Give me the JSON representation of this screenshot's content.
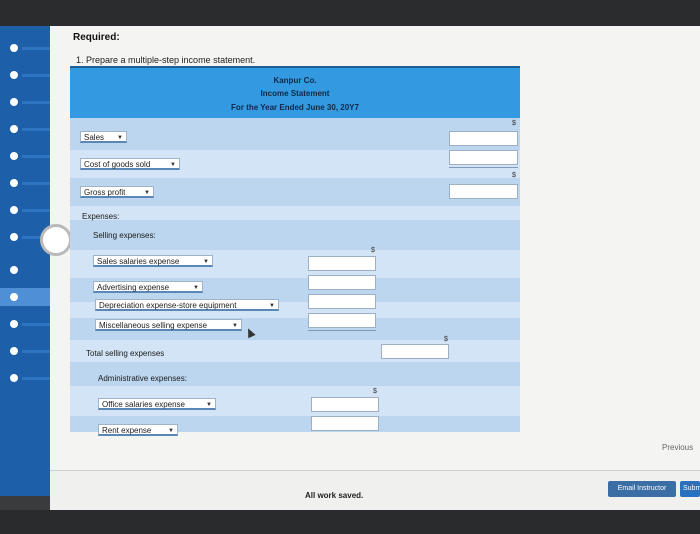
{
  "heading": "Required:",
  "question": "1. Prepare a multiple-step income statement.",
  "statement": {
    "company": "Kanpur Co.",
    "title": "Income Statement",
    "period": "For the Year Ended June 30, 20Y7"
  },
  "rows": {
    "sales": "Sales",
    "cogs": "Cost of goods sold",
    "gross_profit": "Gross profit",
    "expenses": "Expenses:",
    "selling_expenses": "Selling expenses:",
    "sales_salaries": "Sales salaries expense",
    "advertising": "Advertising expense",
    "depreciation": "Depreciation expense-store equipment",
    "misc_selling": "Miscellaneous selling expense",
    "total_selling": "Total selling expenses",
    "admin_expenses": "Administrative expenses:",
    "office_salaries": "Office salaries expense",
    "rent": "Rent expense"
  },
  "currency_symbol": "$",
  "footer": {
    "previous": "Previous",
    "saved": "All work saved.",
    "email_instructor": "Email Instructor",
    "submit": "Subm"
  }
}
